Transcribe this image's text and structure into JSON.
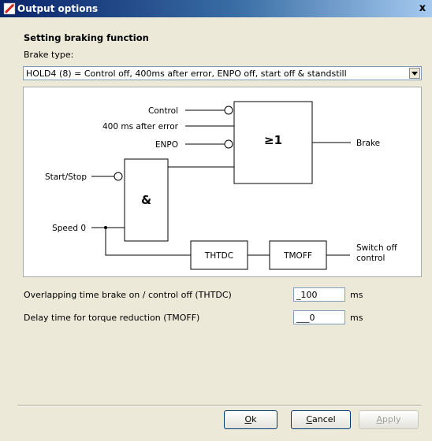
{
  "window": {
    "title": "Output options",
    "close_label": "x"
  },
  "section_title": "Setting braking function",
  "brake_type": {
    "label": "Brake type:",
    "selected": "HOLD4 (8) = Control off, 400ms after error, ENPO off, start off & standstill"
  },
  "diagram": {
    "inputs": {
      "control": "Control",
      "after_error": "400 ms after error",
      "enpo": "ENPO",
      "start_stop": "Start/Stop",
      "speed0": "Speed 0"
    },
    "gates": {
      "or": "≥1",
      "and": "&"
    },
    "blocks": {
      "thtdc": "THTDC",
      "tmoff": "TMOFF"
    },
    "outputs": {
      "brake": "Brake",
      "switch_off_1": "Switch off",
      "switch_off_2": "control"
    }
  },
  "params": [
    {
      "label": "Overlapping time brake on / control off (THTDC)",
      "value": "_100",
      "unit": "ms"
    },
    {
      "label": "Delay time for torque reduction (TMOFF)",
      "value": "___0",
      "unit": "ms"
    }
  ],
  "buttons": {
    "ok_first": "O",
    "ok_rest": "k",
    "cancel_first": "C",
    "cancel_rest": "ancel",
    "apply_first": "A",
    "apply_rest": "pply"
  }
}
